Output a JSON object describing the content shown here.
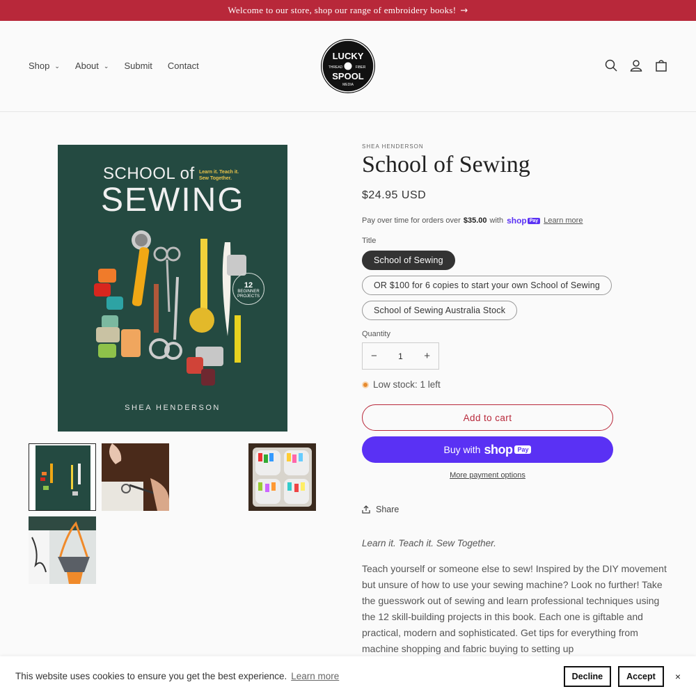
{
  "announcement": {
    "text": "Welcome to our store, shop our range of embroidery books!",
    "arrow": "→"
  },
  "nav": {
    "items": [
      {
        "label": "Shop",
        "has_dropdown": true
      },
      {
        "label": "About",
        "has_dropdown": true
      },
      {
        "label": "Submit",
        "has_dropdown": false
      },
      {
        "label": "Contact",
        "has_dropdown": false
      }
    ]
  },
  "logo": {
    "line1": "LUCKY",
    "line2": "SPOOL",
    "left": "THREAD",
    "right": "FIBER",
    "bottom": "MEDIA"
  },
  "header_icons": [
    "search-icon",
    "account-icon",
    "cart-icon"
  ],
  "cover": {
    "title_small": "SCHOOL of",
    "title_big": "SEWING",
    "tagline": "Learn it. Teach it. Sew Together.",
    "badge_number": "12",
    "badge_text": "BEGINNER PROJECTS",
    "author": "SHEA HENDERSON"
  },
  "product": {
    "vendor": "SHEA HENDERSON",
    "title": "School of Sewing",
    "price": "$24.95 USD",
    "installments": {
      "prefix": "Pay over time for orders over",
      "amount": "$35.00",
      "with": "with",
      "brand": "shop",
      "pay": "Pay",
      "link": "Learn more"
    },
    "option_label": "Title",
    "options": [
      {
        "label": "School of Sewing",
        "selected": true
      },
      {
        "label": "OR $100 for 6 copies to start your own School of Sewing",
        "selected": false
      },
      {
        "label": "School of Sewing Australia Stock",
        "selected": false
      }
    ],
    "quantity_label": "Quantity",
    "quantity": "1",
    "minus": "−",
    "plus": "+",
    "stock": "Low stock: 1 left",
    "add_to_cart": "Add to cart",
    "buy_with": "Buy with",
    "buy_brand": "shop",
    "buy_pay": "Pay",
    "more_payment": "More payment options",
    "share": "Share",
    "tagline": "Learn it. Teach it. Sew Together.",
    "description": "Teach yourself or someone else to sew! Inspired by the DIY movement but unsure of how to use your sewing machine? Look no further! Take the guesswork out of sewing and learn professional techniques using the 12 skill-building projects in this book. Each one is giftable and practical, modern and sophisticated. Get tips for everything from machine shopping and fabric buying to setting up"
  },
  "colors": {
    "accent": "#b8283a",
    "shop_pay": "#5a31f4",
    "cover_green": "#244a41",
    "low_stock": "#e68a2e"
  },
  "cookie": {
    "message": "This website uses cookies to ensure you get the best experience.",
    "learn": "Learn more",
    "decline": "Decline",
    "accept": "Accept",
    "close": "×"
  }
}
